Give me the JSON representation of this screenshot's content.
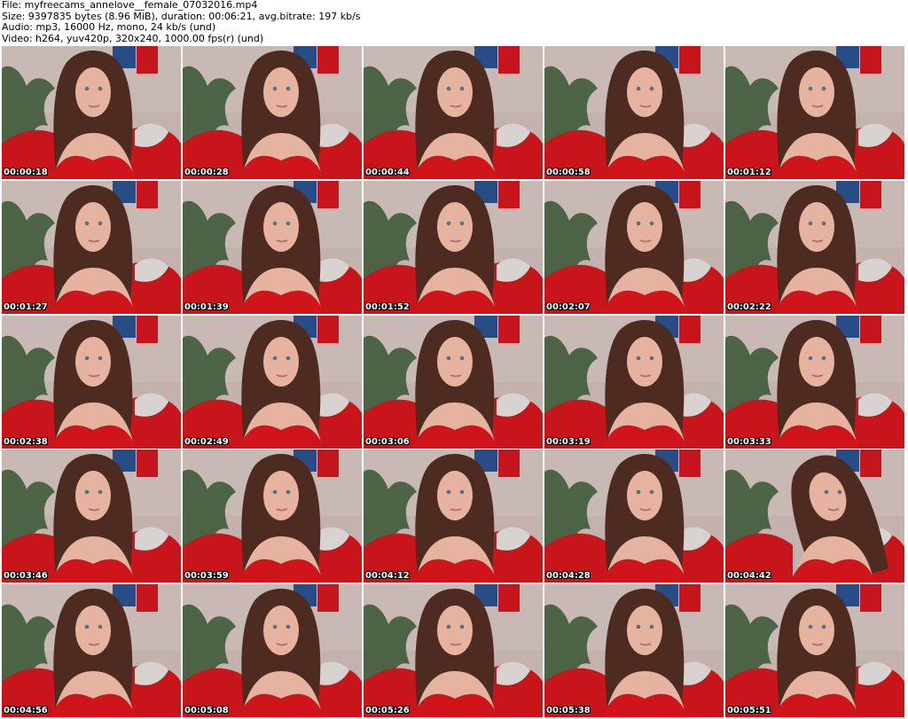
{
  "header": {
    "file": "File: myfreecams_annelove__female_07032016.mp4",
    "size": "Size: 9397835 bytes (8.96 MiB), duration: 00:06:21, avg.bitrate: 197 kb/s",
    "audio": "Audio: mp3, 16000 Hz, mono, 24 kb/s (und)",
    "video": "Video: h264, yuv420p, 320x240, 1000.00 fps(r) (und)"
  },
  "thumbnails": [
    {
      "timestamp": "00:00:18"
    },
    {
      "timestamp": "00:00:28"
    },
    {
      "timestamp": "00:00:44"
    },
    {
      "timestamp": "00:00:58"
    },
    {
      "timestamp": "00:01:12"
    },
    {
      "timestamp": "00:01:27"
    },
    {
      "timestamp": "00:01:39"
    },
    {
      "timestamp": "00:01:52"
    },
    {
      "timestamp": "00:02:07"
    },
    {
      "timestamp": "00:02:22"
    },
    {
      "timestamp": "00:02:38"
    },
    {
      "timestamp": "00:02:49"
    },
    {
      "timestamp": "00:03:06"
    },
    {
      "timestamp": "00:03:19"
    },
    {
      "timestamp": "00:03:33"
    },
    {
      "timestamp": "00:03:46"
    },
    {
      "timestamp": "00:03:59"
    },
    {
      "timestamp": "00:04:12"
    },
    {
      "timestamp": "00:04:28"
    },
    {
      "timestamp": "00:04:42"
    },
    {
      "timestamp": "00:04:56"
    },
    {
      "timestamp": "00:05:08"
    },
    {
      "timestamp": "00:05:26"
    },
    {
      "timestamp": "00:05:38"
    },
    {
      "timestamp": "00:05:51"
    }
  ],
  "colors": {
    "wall": "#c9b9b4",
    "sofa": "#c8151b",
    "plant": "#3f5b3a",
    "art_blue": "#274c86",
    "art_red": "#c7151e",
    "hair": "#4d2b20",
    "skin": "#e6b3a1",
    "dress": "#d0141c",
    "pillow": "#d8d3d0"
  }
}
